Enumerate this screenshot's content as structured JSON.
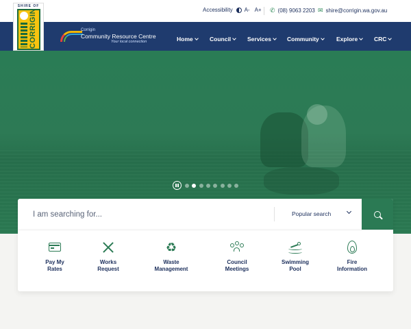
{
  "logo": {
    "shire_of": "SHIRE OF",
    "name": "CORRIGIN"
  },
  "utility": {
    "accessibility": "Accessibility",
    "font_decrease": "A-",
    "font_increase": "A+",
    "phone": "(08) 9063 2203",
    "email": "shire@corrigin.wa.gov.au"
  },
  "crc": {
    "small": "Corrigin",
    "name": "Community Resource Centre",
    "tagline": "Your local connection"
  },
  "nav": {
    "items": [
      {
        "label": "Home"
      },
      {
        "label": "Council"
      },
      {
        "label": "Services"
      },
      {
        "label": "Community"
      },
      {
        "label": "Explore"
      },
      {
        "label": "CRC"
      }
    ]
  },
  "slider": {
    "slide_count": 8,
    "active_index": 1
  },
  "search": {
    "placeholder": "I am searching for...",
    "popular_label": "Popular search"
  },
  "quick_links": [
    {
      "label": "Pay My\nRates",
      "icon": "credit-card-icon"
    },
    {
      "label": "Works\nRequest",
      "icon": "tools-icon"
    },
    {
      "label": "Waste\nManagement",
      "icon": "recycle-icon"
    },
    {
      "label": "Council\nMeetings",
      "icon": "people-icon"
    },
    {
      "label": "Swimming\nPool",
      "icon": "swimming-icon"
    },
    {
      "label": "Fire\nInformation",
      "icon": "fire-icon"
    }
  ],
  "colors": {
    "navy": "#1f3b6e",
    "green": "#2b7a54",
    "text": "#1c2f5c",
    "background": "#f4f4f2"
  }
}
